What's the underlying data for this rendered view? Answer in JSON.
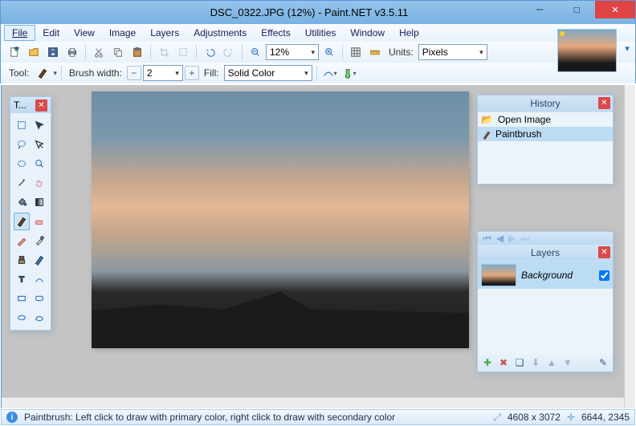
{
  "window": {
    "title": "DSC_0322.JPG (12%) - Paint.NET v3.5.11",
    "min": "—",
    "max": "☐",
    "close": "✕"
  },
  "menu": [
    "File",
    "Edit",
    "View",
    "Image",
    "Layers",
    "Adjustments",
    "Effects",
    "Utilities",
    "Window",
    "Help"
  ],
  "toolbar": {
    "zoom_value": "12%",
    "units_label": "Units:",
    "units_value": "Pixels",
    "tool_label": "Tool:",
    "brushwidth_label": "Brush width:",
    "brushwidth_value": "2",
    "fill_label": "Fill:",
    "fill_value": "Solid Color"
  },
  "tools_window": {
    "title": "T..."
  },
  "history": {
    "title": "History",
    "items": [
      {
        "icon": "folder-icon",
        "label": "Open Image"
      },
      {
        "icon": "brush-icon",
        "label": "Paintbrush"
      }
    ]
  },
  "layers": {
    "title": "Layers",
    "items": [
      {
        "name": "Background",
        "visible": true
      }
    ]
  },
  "status": {
    "hint": "Paintbrush: Left click to draw with primary color, right click to draw with secondary color",
    "dims": "4608 x 3072",
    "cursor": "6644, 2345"
  }
}
